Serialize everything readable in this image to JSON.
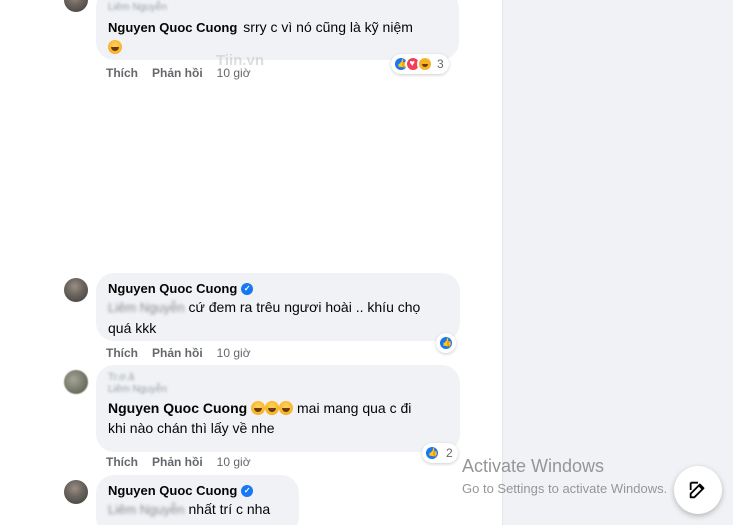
{
  "comments": [
    {
      "author": "Nguyen Quoc Cuong",
      "reply_to": "Liêm Nguyễn",
      "text": "srry c vì nó cũng là kỹ niệm",
      "like_label": "Thích",
      "reply_label": "Phản hồi",
      "time": "10 giờ",
      "reaction_count": "3",
      "reactions": [
        "like-icon",
        "love-icon",
        "haha-icon"
      ]
    },
    {
      "author": "Nguyen Quoc Cuong",
      "verified": true,
      "reply_to": "Liêm Nguyễn",
      "text_line1": "cứ đem ra trêu ngươi hoài .. khíu chọ",
      "text_line2": "quá kkk",
      "like_label": "Thích",
      "reply_label": "Phản hồi",
      "time": "10 giờ",
      "reactions": [
        "like-icon"
      ]
    },
    {
      "author": "Nguyen Quoc Cuong",
      "reply_header": "Tr.ơ.ả",
      "reply_to": "Liêm Nguyễn",
      "text_line1": "mai mang qua c đi",
      "text_line2": "khi nào chán thì lấy về nhe",
      "like_label": "Thích",
      "reply_label": "Phản hồi",
      "time": "10 giờ",
      "reaction_count": "2",
      "reactions": [
        "like-icon"
      ]
    },
    {
      "author": "Nguyen Quoc Cuong",
      "verified": true,
      "reply_to": "Liêm Nguyễn",
      "text": "nhất trí c nha"
    }
  ],
  "watermark": "Tiin.vn",
  "activate_windows": {
    "title": "Activate Windows",
    "subtitle": "Go to Settings to activate Windows."
  },
  "compose_button_icon": "edit-icon",
  "colors": {
    "bubble": "#f0f2f5",
    "meta": "#65676b",
    "verified": "#1877f2"
  }
}
